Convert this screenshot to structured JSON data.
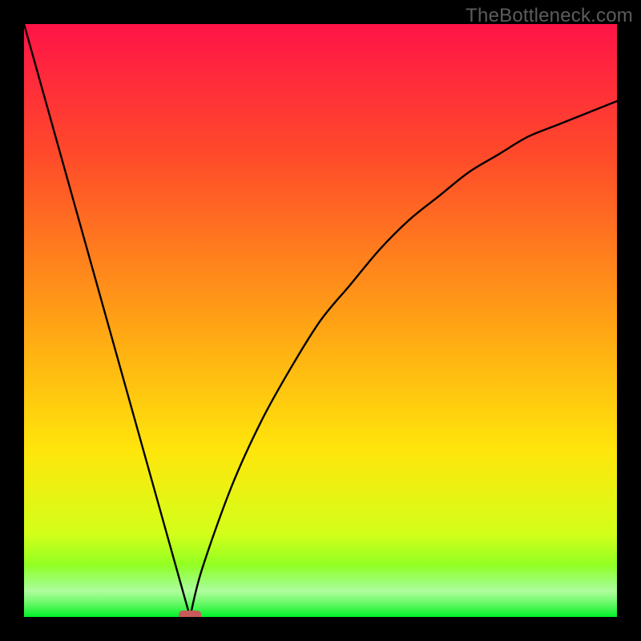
{
  "watermark": "TheBottleneck.com",
  "chart_data": {
    "type": "line",
    "title": "",
    "xlabel": "",
    "ylabel": "",
    "xlim": [
      0,
      100
    ],
    "ylim": [
      0,
      100
    ],
    "note": "V-shaped curve with minimum at x≈28; left arm linear from top-left to vertex, right arm rises with decreasing slope toward top-right (~87 at x=100).",
    "series": [
      {
        "name": "left-arm",
        "x": [
          0,
          28
        ],
        "y": [
          100,
          0
        ]
      },
      {
        "name": "right-arm",
        "x": [
          28,
          30,
          35,
          40,
          45,
          50,
          55,
          60,
          65,
          70,
          75,
          80,
          85,
          90,
          95,
          100
        ],
        "y": [
          0,
          8,
          22,
          33,
          42,
          50,
          56,
          62,
          67,
          71,
          75,
          78,
          81,
          83,
          85,
          87
        ]
      }
    ],
    "marker": {
      "x": 28,
      "y": 0,
      "color": "#c85a5a",
      "shape": "rounded-rect"
    },
    "band": {
      "y": 0,
      "height_fraction": 0.04,
      "color_center": "#00f12a"
    },
    "gradient": {
      "stops": [
        {
          "offset": 0.0,
          "color": "#ff1447"
        },
        {
          "offset": 0.22,
          "color": "#ff4a2a"
        },
        {
          "offset": 0.5,
          "color": "#ffa115"
        },
        {
          "offset": 0.72,
          "color": "#ffe60b"
        },
        {
          "offset": 0.86,
          "color": "#d3ff1a"
        },
        {
          "offset": 0.93,
          "color": "#7cff25"
        },
        {
          "offset": 1.0,
          "color": "#00f12a"
        }
      ]
    }
  }
}
